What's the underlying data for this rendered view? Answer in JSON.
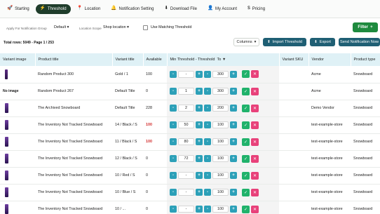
{
  "nav": {
    "items": [
      {
        "label": "Starting",
        "icon": "rocket-icon",
        "glyph": "🚀",
        "active": false
      },
      {
        "label": "Threshold",
        "icon": "lightning-icon",
        "glyph": "⚡",
        "active": true
      },
      {
        "label": "Location",
        "icon": "pin-icon",
        "glyph": "📍",
        "active": false
      },
      {
        "label": "Notification Setting",
        "icon": "bell-icon",
        "glyph": "🔔",
        "active": false
      },
      {
        "label": "Download File",
        "icon": "download-icon",
        "glyph": "⬇",
        "active": false
      },
      {
        "label": "My Account",
        "icon": "user-icon",
        "glyph": "👤",
        "active": false
      },
      {
        "label": "Pricing",
        "icon": "dollar-icon",
        "glyph": "$",
        "active": false
      }
    ]
  },
  "toolbar": {
    "group_label": "Apply For Notification Group",
    "group_value": "Default",
    "scope_label": "Location Scope",
    "scope_value": "Shop location",
    "matching_label": "Use Matching Threshold",
    "filter_label": "Filter",
    "filter_icon": "+"
  },
  "summary": {
    "total": "Total rows: 5049 - Page 1 / 253"
  },
  "actions": {
    "columns": "Columns",
    "import": "Import Threshold",
    "export": "Export",
    "send": "Send Notification Now"
  },
  "table": {
    "headers": {
      "image": "Variant image",
      "product": "Product title",
      "variant": "Variant title",
      "available": "Available",
      "threshold": "Min Threshold - Threshold",
      "threshold_sort": "To",
      "sku": "Variant SKU",
      "vendor": "Vendor",
      "type": "Product type"
    },
    "rows": [
      {
        "image": "thumb-a",
        "image_text": "",
        "product": "Random Product 300",
        "variant": "Gold / 1",
        "available": "100",
        "avail_red": false,
        "min": "-",
        "max": "300",
        "vendor": "Acme",
        "type": "Snowboard"
      },
      {
        "image": "none",
        "image_text": "No image",
        "product": "Random Product 267",
        "variant": "Default Title",
        "available": "0",
        "avail_red": false,
        "min": "1",
        "max": "300",
        "vendor": "Acme",
        "type": "Snowboard"
      },
      {
        "image": "thumb-b",
        "image_text": "",
        "product": "The Archived Snowboard",
        "variant": "Default Title",
        "available": "228",
        "avail_red": false,
        "min": "2",
        "max": "200",
        "vendor": "Demo Vendor",
        "type": "Snowboard"
      },
      {
        "image": "thumb-b",
        "image_text": "",
        "product": "The Inventory Not Tracked Snowboard",
        "variant": "14 / Black / S",
        "available": "100",
        "avail_red": true,
        "min": "50",
        "max": "100",
        "vendor": "test-example-store",
        "type": "Snowboard"
      },
      {
        "image": "thumb-b",
        "image_text": "",
        "product": "The Inventory Not Tracked Snowboard",
        "variant": "11 / Black / S",
        "available": "100",
        "avail_red": true,
        "min": "80",
        "max": "100",
        "vendor": "test-example-store",
        "type": "Snowboard"
      },
      {
        "image": "thumb-b",
        "image_text": "",
        "product": "The Inventory Not Tracked Snowboard",
        "variant": "12 / Black / S",
        "available": "0",
        "avail_red": false,
        "min": "72",
        "max": "100",
        "vendor": "test-example-store",
        "type": "Snowboard"
      },
      {
        "image": "thumb-b",
        "image_text": "",
        "product": "The Inventory Not Tracked Snowboard",
        "variant": "10 / Red / S",
        "available": "0",
        "avail_red": false,
        "min": "-",
        "max": "100",
        "vendor": "test-example-store",
        "type": "Snowboard"
      },
      {
        "image": "thumb-b",
        "image_text": "",
        "product": "The Inventory Not Tracked Snowboard",
        "variant": "10 / Blue / S",
        "available": "0",
        "avail_red": false,
        "min": "-",
        "max": "100",
        "vendor": "test-example-store",
        "type": "Snowboard"
      },
      {
        "image": "thumb-b",
        "image_text": "",
        "product": "The Inventory Not Tracked Snowboard",
        "variant": "10 / ...",
        "available": "0",
        "avail_red": false,
        "min": "-",
        "max": "100",
        "vendor": "test-example-store",
        "type": "Snowboard"
      }
    ]
  },
  "colors": {
    "nav_active_bg": "#1f3d2b",
    "filter_bg": "#1e8a3e",
    "action_bg": "#1f5f74",
    "header_bg": "#dff1f6",
    "stepper": "#2ca0b8",
    "confirm": "#20b26b",
    "cancel": "#e8417a",
    "low_stock": "#d32f2f"
  }
}
